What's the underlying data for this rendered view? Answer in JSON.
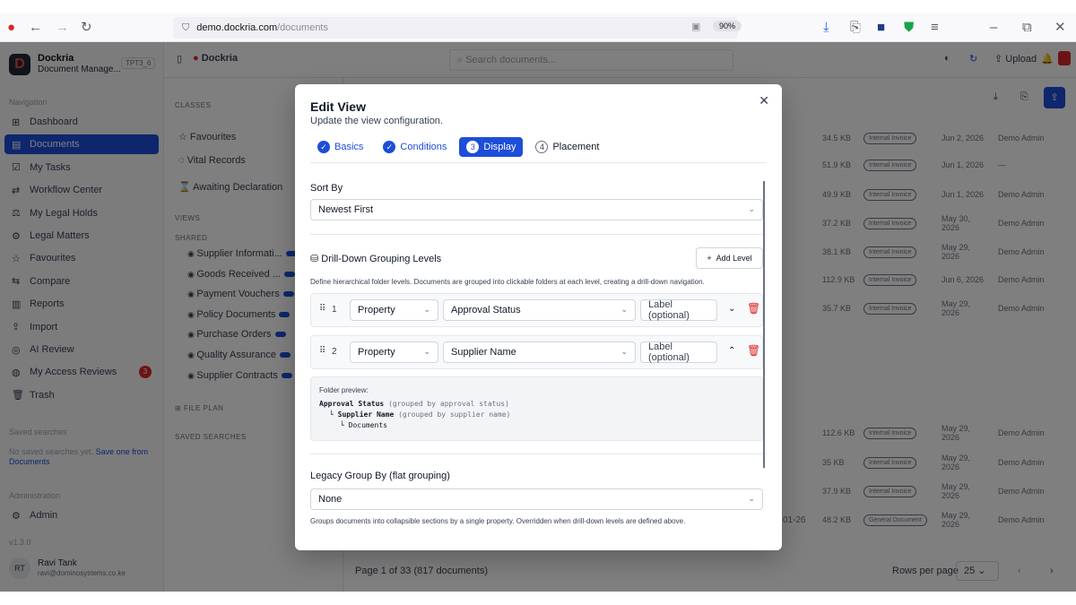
{
  "browser": {
    "url_domain": "demo.dockria.com",
    "url_path": "/documents",
    "zoom": "90%"
  },
  "app": {
    "name": "Dockria",
    "subtitle": "Document Manage...",
    "env_badge": "TPT3_6",
    "nav_label": "Navigation",
    "nav": [
      {
        "icon": "dashboard-icon",
        "glyph": "⊞",
        "label": "Dashboard"
      },
      {
        "icon": "documents-icon",
        "glyph": "▤",
        "label": "Documents"
      },
      {
        "icon": "tasks-icon",
        "glyph": "☑",
        "label": "My Tasks"
      },
      {
        "icon": "workflow-icon",
        "glyph": "⇄",
        "label": "Workflow Center"
      },
      {
        "icon": "gavel-icon",
        "glyph": "⚖",
        "label": "My Legal Holds"
      },
      {
        "icon": "legal-matters-icon",
        "glyph": "⚙",
        "label": "Legal Matters"
      },
      {
        "icon": "star-icon",
        "glyph": "☆",
        "label": "Favourites"
      },
      {
        "icon": "compare-icon",
        "glyph": "⇆",
        "label": "Compare"
      },
      {
        "icon": "reports-icon",
        "glyph": "▥",
        "label": "Reports"
      },
      {
        "icon": "import-icon",
        "glyph": "⇪",
        "label": "Import"
      },
      {
        "icon": "ai-review-icon",
        "glyph": "◎",
        "label": "AI Review"
      },
      {
        "icon": "access-reviews-icon",
        "glyph": "◍",
        "label": "My Access Reviews",
        "badge": "3"
      },
      {
        "icon": "trash-icon",
        "glyph": "🗑",
        "label": "Trash"
      }
    ],
    "saved_searches_label": "Saved searches",
    "saved_searches_empty": "No saved searches yet.",
    "saved_searches_link": "Save one from Documents",
    "admin_label": "Administration",
    "admin_item": "Admin",
    "version": "v1.3.0",
    "user_initials": "RT",
    "user_name": "Ravi Tank",
    "user_email": "ravi@dominosystems.co.ke",
    "search_placeholder": "Search documents...",
    "upload_label": "Upload",
    "classes_label": "CLASSES",
    "classes": [
      "Favourites",
      "Vital Records",
      "Awaiting Declaration"
    ],
    "views_label": "VIEWS",
    "shared_label": "SHARED",
    "views": [
      "Supplier Informati...",
      "Goods Received ...",
      "Payment Vouchers",
      "Policy Documents",
      "Purchase Orders",
      "Quality Assurance",
      "Supplier Contracts"
    ],
    "file_plan_label": "FILE PLAN",
    "saved_searches_section": "SAVED SEARCHES",
    "pagination": "Page 1 of 33 (817 documents)",
    "rows_per_page_label": "Rows per page",
    "rows_per_page": "25"
  },
  "table_rows": [
    {
      "size": "34.5 KB",
      "type": "Internal Invoice",
      "date": "Jun 2, 2026",
      "user": "Demo Admin"
    },
    {
      "size": "51.9 KB",
      "type": "Internal Invoice",
      "date": "Jun 1, 2026",
      "user": "—"
    },
    {
      "size": "49.9 KB",
      "type": "Internal Invoice",
      "date": "Jun 1, 2026",
      "user": "Demo Admin"
    },
    {
      "size": "37.2 KB",
      "type": "Internal Invoice",
      "date": "May 30, 2026",
      "user": "Demo Admin"
    },
    {
      "size": "38.1 KB",
      "type": "Internal Invoice",
      "date": "May 29, 2026",
      "user": "Demo Admin"
    },
    {
      "size": "112.9 KB",
      "type": "Internal Invoice",
      "date": "Jun 6, 2026",
      "user": "Demo Admin"
    },
    {
      "size": "35.7 KB",
      "type": "Internal Invoice",
      "date": "May 29, 2026",
      "user": "Demo Admin"
    },
    {
      "size": "112.6 KB",
      "type": "Internal Invoice",
      "date": "May 29, 2026",
      "user": "Demo Admin"
    },
    {
      "size": "35 KB",
      "type": "Internal Invoice",
      "date": "May 29, 2026",
      "user": "Demo Admin"
    },
    {
      "size": "37.9 KB",
      "type": "Internal Invoice",
      "date": "May 29, 2026",
      "user": "Demo Admin"
    },
    {
      "size": "48.2 KB",
      "type": "General Document",
      "date": "May 29, 2026",
      "user": "Demo Admin",
      "prefix": "01-26"
    }
  ],
  "modal": {
    "title": "Edit View",
    "subtitle": "Update the view configuration.",
    "steps": [
      {
        "num": "✓",
        "label": "Basics",
        "state": "done"
      },
      {
        "num": "✓",
        "label": "Conditions",
        "state": "done"
      },
      {
        "num": "3",
        "label": "Display",
        "state": "current"
      },
      {
        "num": "4",
        "label": "Placement",
        "state": "todo"
      }
    ],
    "sort_label": "Sort By",
    "sort_value": "Newest First",
    "drill_title": "Drill-Down Grouping Levels",
    "add_level": "Add Level",
    "drill_help": "Define hierarchical folder levels. Documents are grouped into clickable folders at each level, creating a drill-down navigation.",
    "levels": [
      {
        "num": "1",
        "source": "Property",
        "field": "Approval Status",
        "label_placeholder": "Label (optional)",
        "order_icon": "⌄"
      },
      {
        "num": "2",
        "source": "Property",
        "field": "Supplier Name",
        "label_placeholder": "Label (optional)",
        "order_icon": "⌃"
      }
    ],
    "preview_title": "Folder preview:",
    "preview_l1_key": "Approval Status",
    "preview_l1_note": "(grouped by approval status)",
    "preview_l2_key": "Supplier Name",
    "preview_l2_note": "(grouped by supplier name)",
    "preview_l3": "Documents",
    "legacy_label": "Legacy Group By (flat grouping)",
    "legacy_value": "None",
    "legacy_help": "Groups documents into collapsible sections by a single property. Overridden when drill-down levels are defined above."
  },
  "colors": {
    "primary": "#1d4ed8",
    "danger": "#dc2626"
  }
}
